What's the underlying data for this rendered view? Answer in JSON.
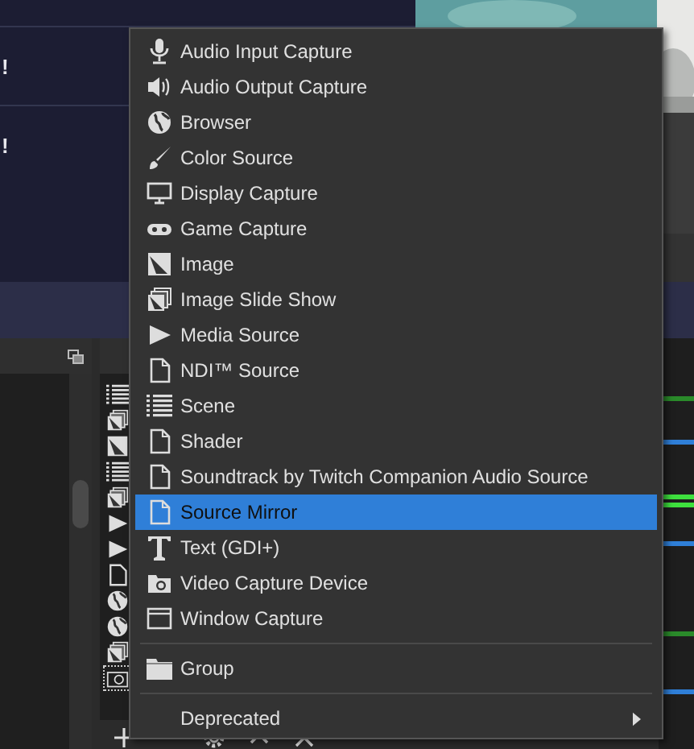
{
  "chat": {
    "messages": [
      "!",
      "!"
    ]
  },
  "menu": {
    "sections": [
      [
        {
          "label": "Audio Input Capture",
          "selected": false,
          "submenu": false
        },
        {
          "label": "Audio Output Capture",
          "selected": false,
          "submenu": false
        },
        {
          "label": "Browser",
          "selected": false,
          "submenu": false
        },
        {
          "label": "Color Source",
          "selected": false,
          "submenu": false
        },
        {
          "label": "Display Capture",
          "selected": false,
          "submenu": false
        },
        {
          "label": "Game Capture",
          "selected": false,
          "submenu": false
        },
        {
          "label": "Image",
          "selected": false,
          "submenu": false
        },
        {
          "label": "Image Slide Show",
          "selected": false,
          "submenu": false
        },
        {
          "label": "Media Source",
          "selected": false,
          "submenu": false
        },
        {
          "label": "NDI™ Source",
          "selected": false,
          "submenu": false
        },
        {
          "label": "Scene",
          "selected": false,
          "submenu": false
        },
        {
          "label": "Shader",
          "selected": false,
          "submenu": false
        },
        {
          "label": "Soundtrack by Twitch Companion Audio Source",
          "selected": false,
          "submenu": false
        },
        {
          "label": "Source Mirror",
          "selected": true,
          "submenu": false
        },
        {
          "label": "Text (GDI+)",
          "selected": false,
          "submenu": false
        },
        {
          "label": "Video Capture Device",
          "selected": false,
          "submenu": false
        },
        {
          "label": "Window Capture",
          "selected": false,
          "submenu": false
        }
      ],
      [
        {
          "label": "Group",
          "selected": false,
          "submenu": false
        }
      ],
      [
        {
          "label": "Deprecated",
          "selected": false,
          "submenu": true
        }
      ]
    ]
  }
}
